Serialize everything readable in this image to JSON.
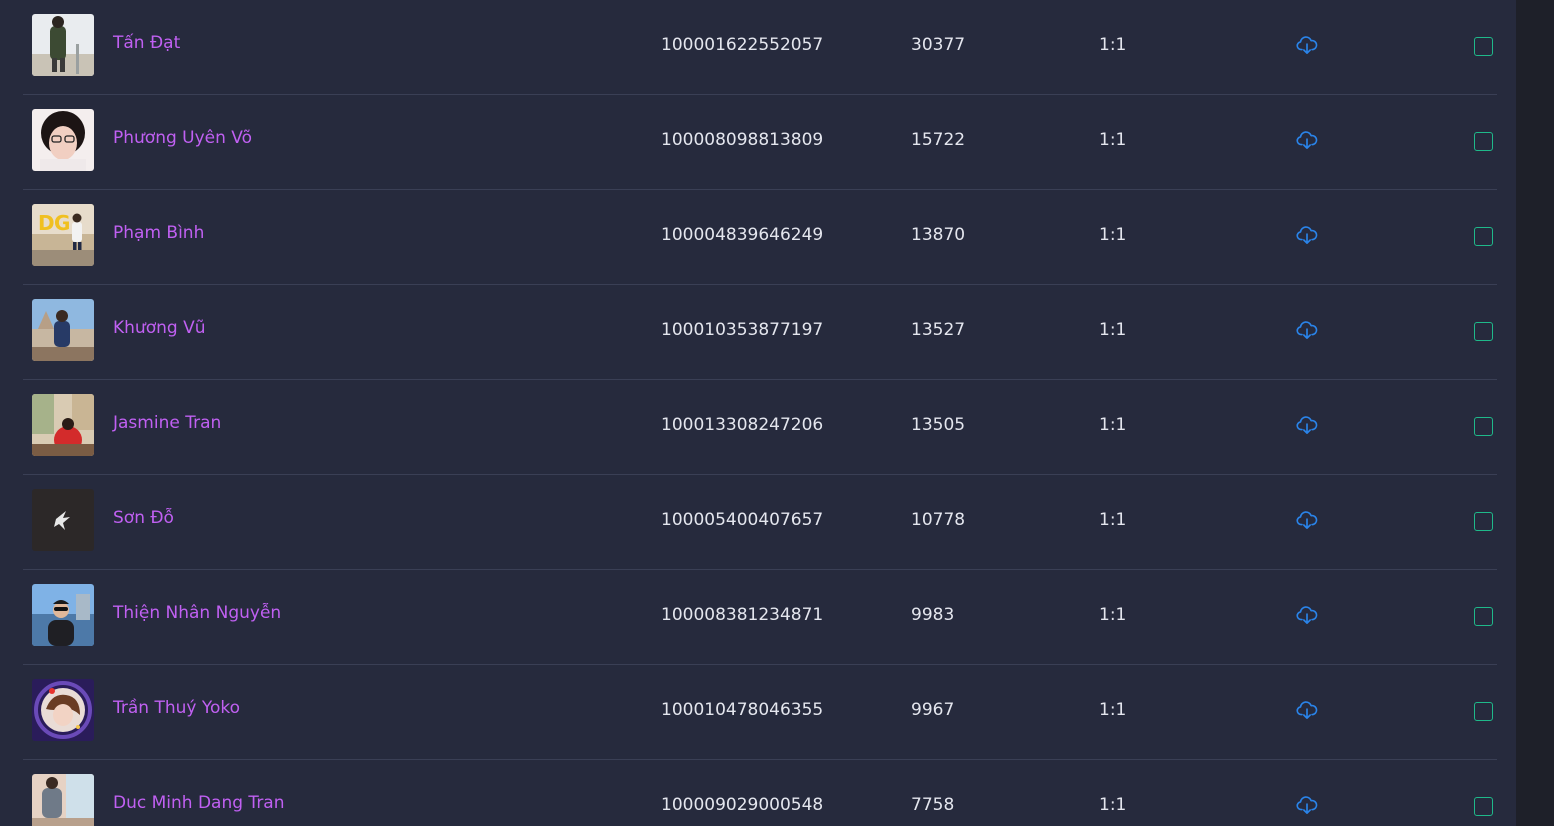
{
  "rows": [
    {
      "name": "Tấn Đạt",
      "uid": "100001622552057",
      "count": "30377",
      "ratio": "1:1",
      "avatar": "avatar-photo-man-standing"
    },
    {
      "name": "Phương Uyên Võ",
      "uid": "100008098813809",
      "count": "15722",
      "ratio": "1:1",
      "avatar": "avatar-photo-girl-glasses"
    },
    {
      "name": "Phạm Bình",
      "uid": "100004839646249",
      "count": "13870",
      "ratio": "1:1",
      "avatar": "avatar-photo-man-with-balloons"
    },
    {
      "name": "Khương Vũ",
      "uid": "100010353877197",
      "count": "13527",
      "ratio": "1:1",
      "avatar": "avatar-photo-man-outdoor"
    },
    {
      "name": "Jasmine Tran",
      "uid": "100013308247206",
      "count": "13505",
      "ratio": "1:1",
      "avatar": "avatar-photo-woman-red-shirt"
    },
    {
      "name": "Sơn Đỗ",
      "uid": "100005400407657",
      "count": "10778",
      "ratio": "1:1",
      "avatar": "avatar-dark-bird-logo"
    },
    {
      "name": "Thiện Nhân Nguyễn",
      "uid": "100008381234871",
      "count": "9983",
      "ratio": "1:1",
      "avatar": "avatar-photo-man-city"
    },
    {
      "name": "Trần Thuý Yoko",
      "uid": "100010478046355",
      "count": "9967",
      "ratio": "1:1",
      "avatar": "avatar-photo-girl-purple-frame"
    },
    {
      "name": "Duc Minh Dang Tran",
      "uid": "100009029000548",
      "count": "7758",
      "ratio": "1:1",
      "avatar": "avatar-photo-man-indoor"
    }
  ],
  "icons": {
    "download": "cloud-download-icon",
    "checkbox": "checkbox-unchecked"
  },
  "colors": {
    "background": "#262a3d",
    "name_link": "#c060f2",
    "text": "#e4e6ee",
    "download_icon": "#2a84ea",
    "checkbox_border": "#1fb98a",
    "row_divider": "#3a3f55"
  }
}
